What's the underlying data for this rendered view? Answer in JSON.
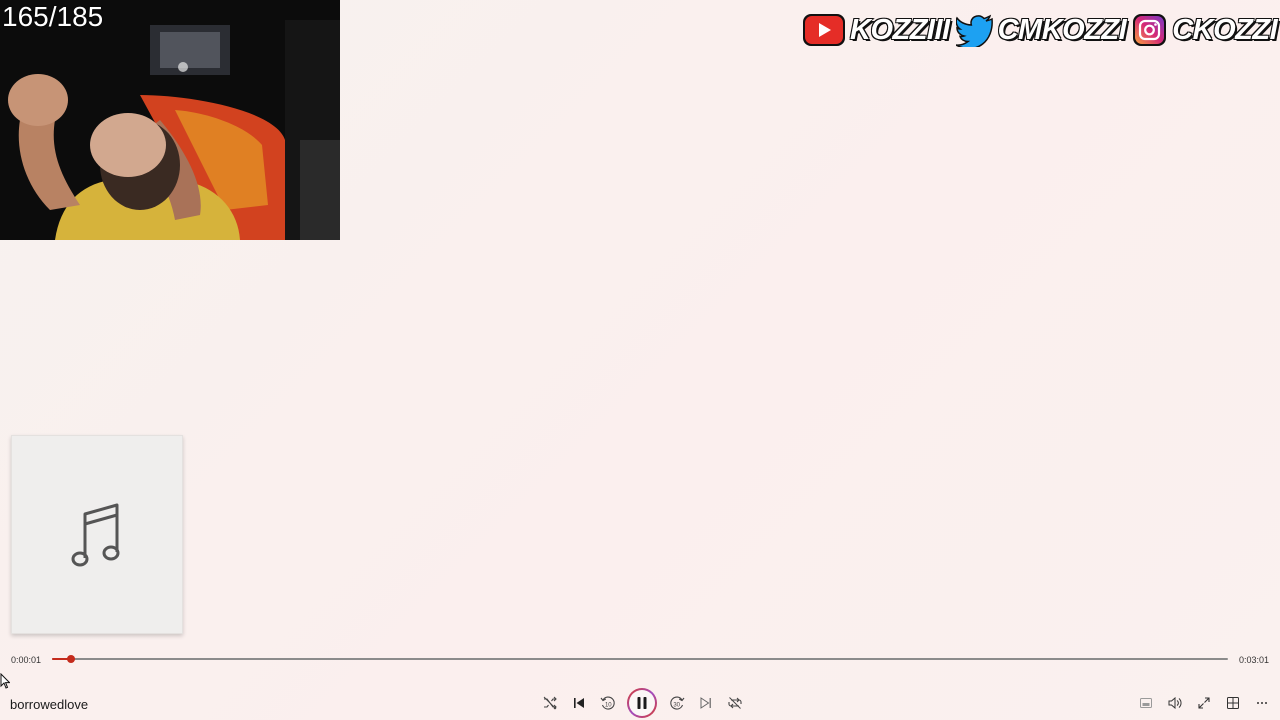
{
  "overlay": {
    "counter": "165/185"
  },
  "socials": [
    {
      "icon": "youtube-icon",
      "handle": "KOZZIII",
      "color": "#e52d27"
    },
    {
      "icon": "twitter-icon",
      "handle": "CMKOZZI",
      "color": "#1da1f2"
    },
    {
      "icon": "instagram-icon",
      "handle": "CKOZZI",
      "color": "#c13584"
    }
  ],
  "album_art": {
    "icon": "music-note-icon"
  },
  "player": {
    "elapsed": "0:00:01",
    "total": "0:03:01",
    "progress": 0.016,
    "track_title": "borrowedlove",
    "skip_back_seconds": "10",
    "skip_forward_seconds": "30",
    "state": "playing",
    "controls": [
      {
        "name": "shuffle-button",
        "icon": "shuffle-icon"
      },
      {
        "name": "previous-button",
        "icon": "previous-icon"
      },
      {
        "name": "skip-back-button",
        "icon": "skip-back-10-icon"
      },
      {
        "name": "play-pause-button",
        "icon": "pause-icon"
      },
      {
        "name": "skip-forward-button",
        "icon": "skip-forward-30-icon"
      },
      {
        "name": "next-button",
        "icon": "next-icon"
      },
      {
        "name": "repeat-button",
        "icon": "repeat-off-icon"
      }
    ],
    "right_controls": [
      {
        "name": "miniplayer-button",
        "icon": "miniplayer-icon"
      },
      {
        "name": "volume-button",
        "icon": "volume-icon"
      },
      {
        "name": "fullscreen-button",
        "icon": "fullscreen-icon"
      },
      {
        "name": "cast-button",
        "icon": "cast-icon"
      },
      {
        "name": "more-options-button",
        "icon": "more-icon"
      }
    ],
    "accent_color": "#c42b1c"
  }
}
